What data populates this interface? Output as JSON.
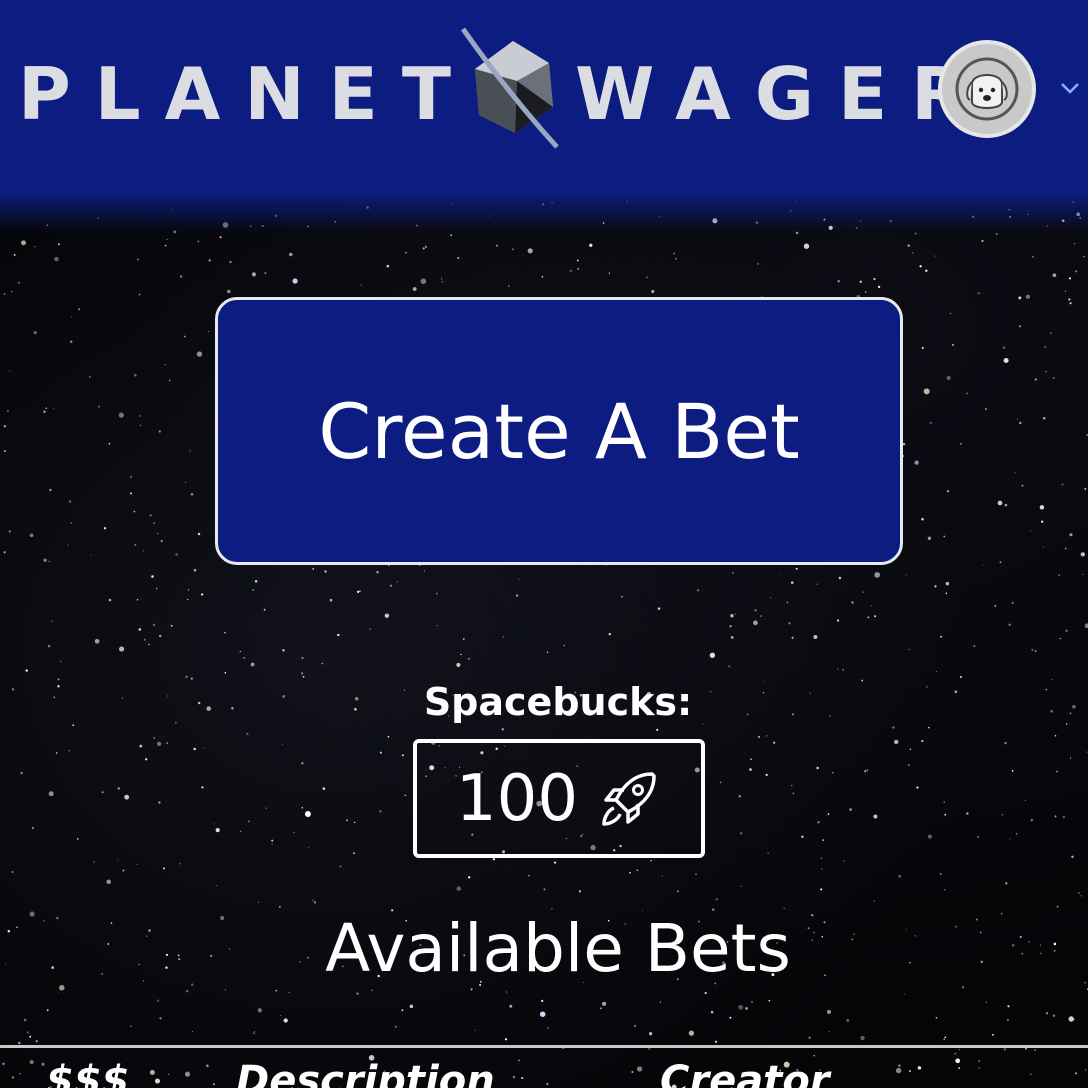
{
  "header": {
    "logo_left": "PLANET",
    "logo_right": "WAGER",
    "avatar_icon": "astronaut-dog-icon",
    "menu_icon": "chevron-down-icon",
    "background_color": "#0c1c80"
  },
  "main": {
    "create_button_label": "Create A Bet",
    "spacebucks_label": "Spacebucks:",
    "spacebucks_value": "100",
    "spacebucks_icon": "rocket-icon",
    "available_bets_title": "Available Bets"
  },
  "bets_table": {
    "columns": [
      "$$$",
      "Description",
      "Creator"
    ]
  }
}
